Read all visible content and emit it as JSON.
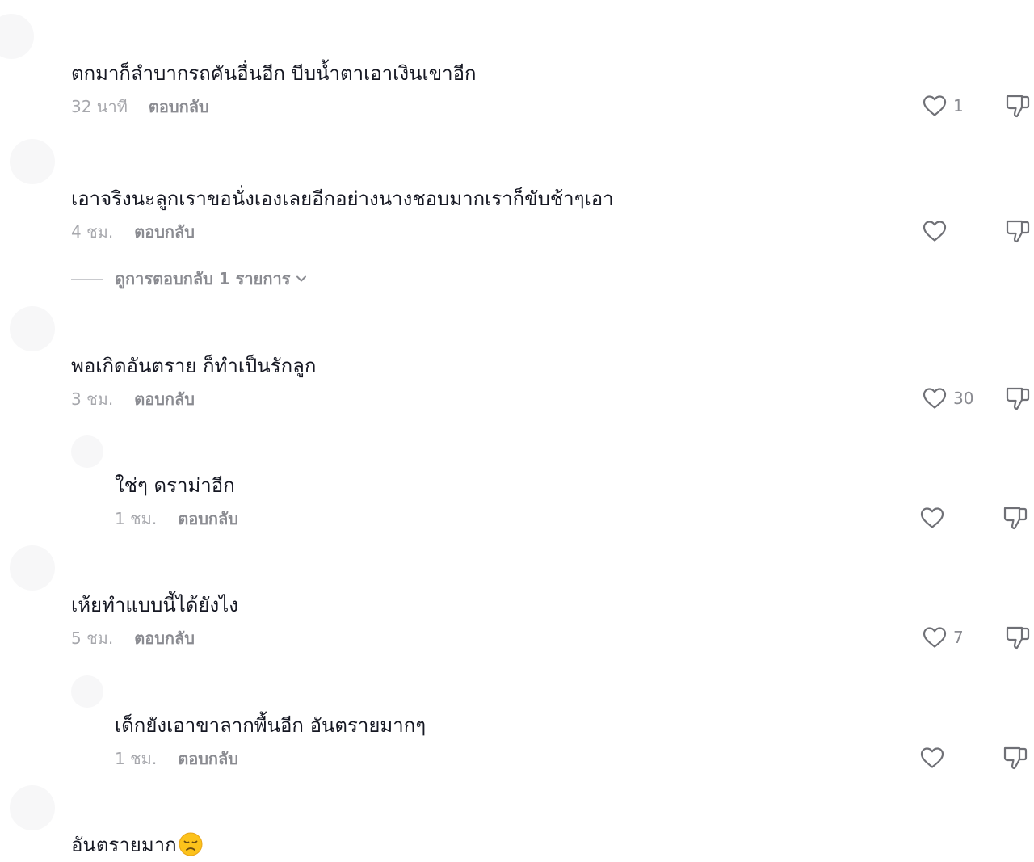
{
  "comments": [
    {
      "username": "",
      "text": "ตกมาก็ลำบากรถคันอื่นอีก บีบน้ำตาเอาเงินเขาอีก",
      "time": "32 นาที",
      "reply_label": "ตอบกลับ",
      "likes": "1"
    },
    {
      "username": "",
      "text": "เอาจริงนะลูกเราขอนั่งเองเลยอีกอย่างนางชอบมากเราก็ขับช้าๆเอา",
      "time": "4 ชม.",
      "reply_label": "ตอบกลับ",
      "likes": ""
    },
    {
      "username": "",
      "text": "พอเกิดอันตราย ก็ทำเป็นรักลูก",
      "time": "3 ชม.",
      "reply_label": "ตอบกลับ",
      "likes": "30"
    },
    {
      "username": "",
      "text": "ใช่ๆ ดราม่าอีก",
      "time": "1 ชม.",
      "reply_label": "ตอบกลับ",
      "likes": ""
    },
    {
      "username": "",
      "text": "เห้ยทำแบบนี้ได้ยังไง",
      "time": "5 ชม.",
      "reply_label": "ตอบกลับ",
      "likes": "7"
    },
    {
      "username": "",
      "text": "เด็กยังเอาขาลากพื้นอีก อันตรายมากๆ",
      "time": "1 ชม.",
      "reply_label": "ตอบกลับ",
      "likes": ""
    },
    {
      "username": "",
      "text": "อันตรายมาก",
      "emoji": "disappointed-face-emoji"
    }
  ],
  "view_replies": {
    "label": "ดูการตอบกลับ 1 รายการ",
    "icon": "chevron-down-icon"
  },
  "icons": {
    "like": "heart-outline-icon",
    "dislike": "thumbs-down-outline-icon"
  },
  "colors": {
    "text": "#161823",
    "muted": "#a7a8ad",
    "reply": "#8a8b91",
    "icon": "#6f7076"
  }
}
